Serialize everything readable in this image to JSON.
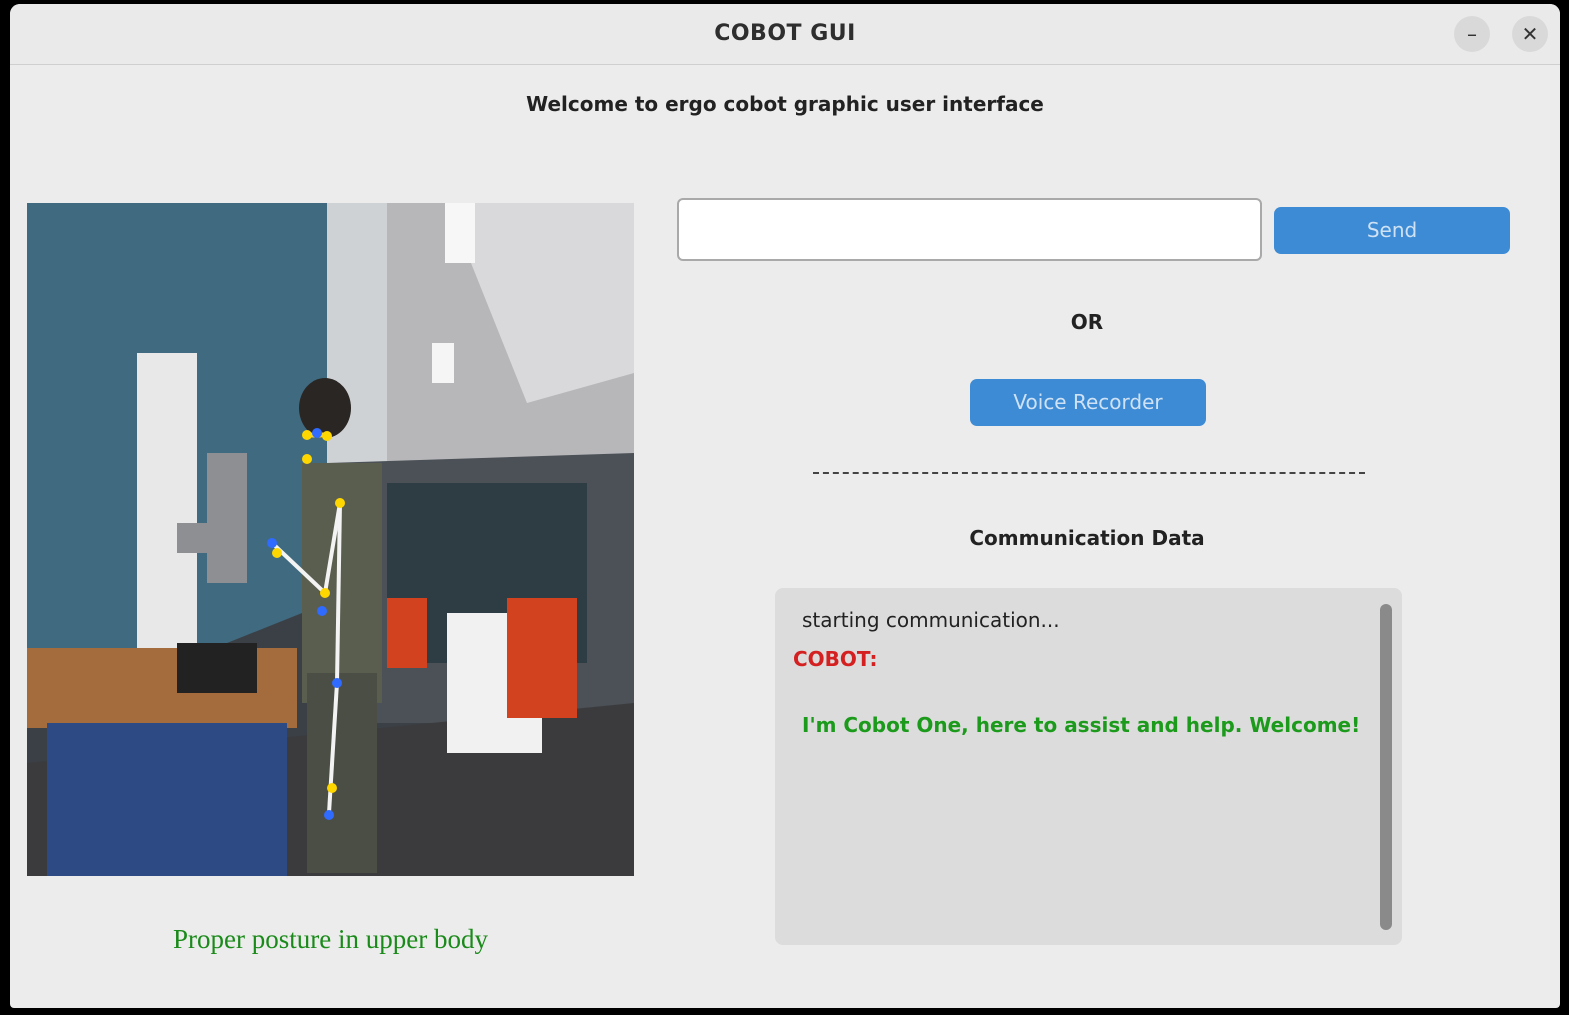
{
  "window": {
    "title": "COBOT GUI",
    "minimize_glyph": "–",
    "close_glyph": "✕"
  },
  "header": {
    "welcome": "Welcome to ergo cobot graphic user interface"
  },
  "camera": {
    "posture_status": "Proper posture in upper body",
    "posture_color": "#1a8a1a"
  },
  "input": {
    "value": "",
    "placeholder": "",
    "send_label": "Send"
  },
  "alt": {
    "or_label": "OR",
    "voice_label": "Voice Recorder",
    "separator": "--------------------------------------------------------------------------------"
  },
  "communication": {
    "title": "Communication Data",
    "status_line": "starting communication...",
    "speaker": "COBOT:",
    "message": "I'm Cobot One, here to assist and help. Welcome!",
    "speaker_color": "#d42020",
    "message_color": "#1c9a1c"
  },
  "colors": {
    "accent": "#3d8bd4",
    "window_bg": "#ececec"
  }
}
